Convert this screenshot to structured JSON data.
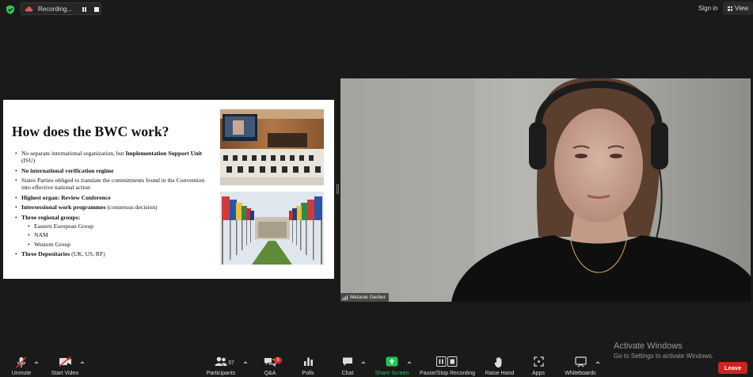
{
  "topbar": {
    "recording_label": "Recording...",
    "sign_in": "Sign in",
    "view": "View"
  },
  "slide": {
    "title": "How does the BWC work?",
    "bullets": {
      "b1_text": "No separate international organization, but ",
      "b1_bold": "Implementation Support Unit",
      "b1_tail": " (ISU)",
      "b2_bold": "No international verification regime",
      "b3_text": "States Parties obliged to translate the commitments found in the Convention into effective national action",
      "b4_bold": "Highest organ: Review Conference",
      "b5_bold": "Intersessional work programmes",
      "b5_tail": " (consensus decision)",
      "b6_bold": "Three regional groups:",
      "sub1": "Eastern European Group",
      "sub2": "NAM",
      "sub3": "Western Group",
      "b7_bold": "Three Depositaries",
      "b7_tail": " (UK, US, RF)"
    }
  },
  "video": {
    "participant_name": "Melanie Gerber"
  },
  "watermark": {
    "line1": "Activate Windows",
    "line2": "Go to Settings to activate Windows."
  },
  "toolbar": {
    "unmute": "Unmute",
    "start_video": "Start Video",
    "participants": "Participants",
    "participant_count": "37",
    "qa": "Q&A",
    "qa_badge": "5",
    "polls": "Polls",
    "chat": "Chat",
    "share_screen": "Share Screen",
    "pause_stop_recording": "Pause/Stop Recording",
    "raise_hand": "Raise Hand",
    "apps": "Apps",
    "whiteboards": "Whiteboards",
    "leave": "Leave"
  },
  "colors": {
    "background": "#1a1a1a",
    "share_green": "#23c552",
    "leave_red": "#c8271f",
    "shield_green": "#35c759"
  }
}
